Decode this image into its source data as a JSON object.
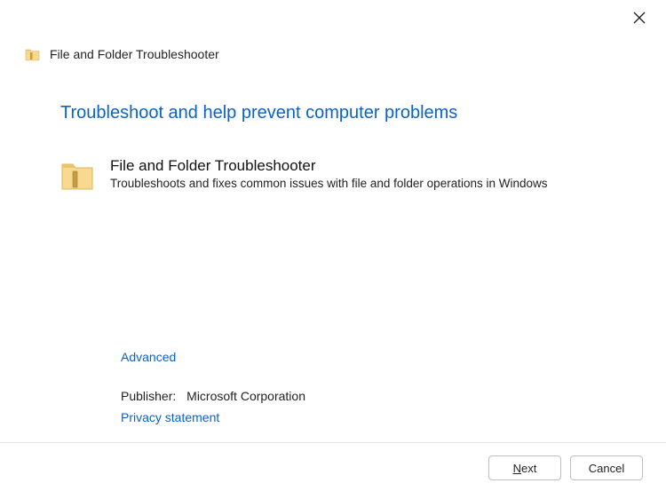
{
  "header": {
    "title": "File and Folder Troubleshooter"
  },
  "main": {
    "heading": "Troubleshoot and help prevent computer problems",
    "section": {
      "title": "File and Folder Troubleshooter",
      "desc": "Troubleshoots and fixes common issues with file and folder operations in Windows"
    },
    "advanced": "Advanced",
    "publisher_label": "Publisher:",
    "publisher_name": "Microsoft Corporation",
    "privacy": "Privacy statement"
  },
  "footer": {
    "next_prefix": "N",
    "next_suffix": "ext",
    "cancel": "Cancel"
  },
  "colors": {
    "link": "#0b63c4"
  }
}
